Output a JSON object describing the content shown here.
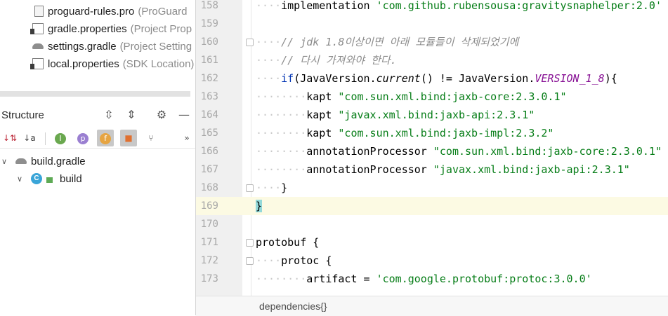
{
  "project_tree": {
    "items": [
      {
        "name": "proguard-rules.pro",
        "desc": "(ProGuard",
        "icon": "file-icon"
      },
      {
        "name": "gradle.properties",
        "desc": "(Project Prop",
        "icon": "properties-icon"
      },
      {
        "name": "settings.gradle",
        "desc": "(Project Setting",
        "icon": "gradle-icon"
      },
      {
        "name": "local.properties",
        "desc": "(SDK Location)",
        "icon": "properties-icon"
      }
    ]
  },
  "structure": {
    "title": "Structure",
    "header_icons": [
      "expand-all-icon",
      "collapse-all-icon",
      "gear-icon",
      "minimize-icon"
    ],
    "toolbar": [
      {
        "name": "sort-by-visibility-icon",
        "glyph": "↓⇅",
        "active": false
      },
      {
        "name": "sort-alphabetically-icon",
        "glyph": "↓a",
        "active": false
      },
      {
        "name": "show-inherited-icon",
        "glyph": "I",
        "active": false
      },
      {
        "name": "show-properties-icon",
        "glyph": "p",
        "active": false
      },
      {
        "name": "show-fields-icon",
        "glyph": "f",
        "active": true
      },
      {
        "name": "show-non-public-icon",
        "glyph": "🔒",
        "active": true
      },
      {
        "name": "autoscroll-icon",
        "glyph": "⑂",
        "active": false
      },
      {
        "name": "more-icon",
        "glyph": "»",
        "active": false
      }
    ],
    "tree": [
      {
        "label": "build.gradle",
        "icon": "gradle-icon",
        "level": 0
      },
      {
        "label": "build",
        "icon": "class-icon",
        "level": 1,
        "badge": "C"
      }
    ]
  },
  "editor": {
    "lines": [
      {
        "n": "158",
        "indent": 1,
        "tokens": [
          [
            "plain",
            "implementation "
          ],
          [
            "s",
            "'com.github.rubensousa:gravitysnaphelper:2.0'"
          ]
        ]
      },
      {
        "n": "159",
        "indent": 0,
        "tokens": []
      },
      {
        "n": "160",
        "indent": 1,
        "fold": true,
        "tokens": [
          [
            "c",
            "// jdk 1.8이상이면 아래 모듈들이 삭제되었기에"
          ]
        ]
      },
      {
        "n": "161",
        "indent": 1,
        "tokens": [
          [
            "c",
            "// 다시 가져와야 한다."
          ]
        ]
      },
      {
        "n": "162",
        "indent": 1,
        "tokens": [
          [
            "k",
            "if"
          ],
          [
            "plain",
            "(JavaVersion."
          ],
          [
            "f",
            "current"
          ],
          [
            "plain",
            "() != JavaVersion."
          ],
          [
            "cn",
            "VERSION_1_8"
          ],
          [
            "plain",
            "){"
          ]
        ]
      },
      {
        "n": "163",
        "indent": 2,
        "tokens": [
          [
            "plain",
            "kapt "
          ],
          [
            "s",
            "\"com.sun.xml.bind:jaxb-core:2.3.0.1\""
          ]
        ]
      },
      {
        "n": "164",
        "indent": 2,
        "tokens": [
          [
            "plain",
            "kapt "
          ],
          [
            "s",
            "\"javax.xml.bind:jaxb-api:2.3.1\""
          ]
        ]
      },
      {
        "n": "165",
        "indent": 2,
        "tokens": [
          [
            "plain",
            "kapt "
          ],
          [
            "s",
            "\"com.sun.xml.bind:jaxb-impl:2.3.2\""
          ]
        ]
      },
      {
        "n": "166",
        "indent": 2,
        "tokens": [
          [
            "plain",
            "annotationProcessor "
          ],
          [
            "s",
            "\"com.sun.xml.bind:jaxb-core:2.3.0.1\""
          ]
        ]
      },
      {
        "n": "167",
        "indent": 2,
        "tokens": [
          [
            "plain",
            "annotationProcessor "
          ],
          [
            "s",
            "\"javax.xml.bind:jaxb-api:2.3.1\""
          ]
        ]
      },
      {
        "n": "168",
        "indent": 1,
        "fold": true,
        "tokens": [
          [
            "plain",
            "}"
          ]
        ]
      },
      {
        "n": "169",
        "indent": 0,
        "current": true,
        "tokens": [
          [
            "hl",
            "}"
          ]
        ]
      },
      {
        "n": "170",
        "indent": 0,
        "tokens": []
      },
      {
        "n": "171",
        "indent": 0,
        "fold": true,
        "tokens": [
          [
            "plain",
            "protobuf {"
          ]
        ]
      },
      {
        "n": "172",
        "indent": 1,
        "fold": true,
        "tokens": [
          [
            "plain",
            "protoc {"
          ]
        ]
      },
      {
        "n": "173",
        "indent": 2,
        "tokens": [
          [
            "plain",
            "artifact = "
          ],
          [
            "s",
            "'com.google.protobuf:protoc:3.0.0'"
          ]
        ]
      }
    ]
  },
  "breadcrumb": {
    "text": "dependencies{}"
  }
}
